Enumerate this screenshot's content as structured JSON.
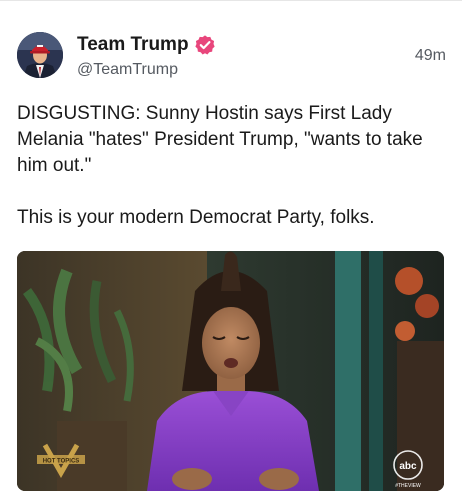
{
  "post": {
    "author": {
      "display_name": "Team Trump",
      "handle": "@TeamTrump",
      "avatar_icon": "profile-photo-avatar",
      "verified_icon": "verified-badge-icon",
      "verified_color": "#e8467c"
    },
    "timestamp": "49m",
    "body": {
      "paragraph_1": "DISGUSTING: Sunny Hostin says First Lady Melania \"hates\" President Trump, \"wants to take him out.\"",
      "paragraph_2": "This is your modern Democrat Party, folks."
    },
    "media": {
      "type": "video-still",
      "show_logo": "HOT TOPICS",
      "network_logo": "abc",
      "hashtag": "#THEVIEW"
    }
  }
}
